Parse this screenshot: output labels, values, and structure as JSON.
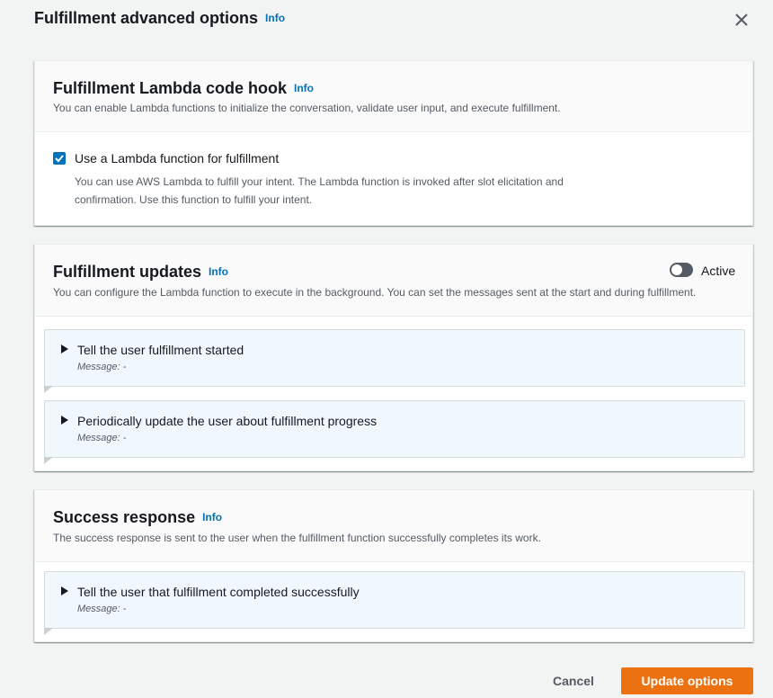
{
  "modal": {
    "title": "Fulfillment advanced options",
    "info": "Info",
    "close_icon": "close-icon"
  },
  "lambda_hook": {
    "title": "Fulfillment Lambda code hook",
    "info": "Info",
    "description": "You can enable Lambda functions to initialize the conversation, validate user input, and execute fulfillment.",
    "checkbox": {
      "checked": true,
      "label": "Use a Lambda function for fulfillment",
      "description": "You can use AWS Lambda to fulfill your intent. The Lambda function is invoked after slot elicitation and confirmation. Use this function to fulfill your intent."
    }
  },
  "updates": {
    "title": "Fulfillment updates",
    "info": "Info",
    "toggle_label": "Active",
    "toggle_on": false,
    "description": "You can configure the Lambda function to execute in the background. You can set the messages sent at the start and during fulfillment.",
    "items": [
      {
        "title": "Tell the user fulfillment started",
        "message": "Message: -"
      },
      {
        "title": "Periodically update the user about fulfillment progress",
        "message": "Message: -"
      }
    ]
  },
  "success": {
    "title": "Success response",
    "info": "Info",
    "description": "The success response is sent to the user when the fulfillment function successfully completes its work.",
    "items": [
      {
        "title": "Tell the user that fulfillment completed successfully",
        "message": "Message: -"
      }
    ]
  },
  "footer": {
    "cancel_label": "Cancel",
    "update_label": "Update options"
  },
  "colors": {
    "accent": "#0073bb",
    "primary_button": "#ec7211",
    "expandable_bg": "#f1f8fd"
  }
}
